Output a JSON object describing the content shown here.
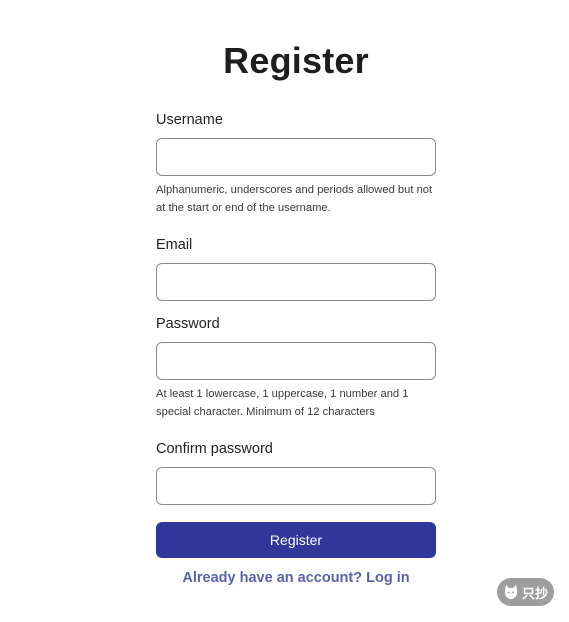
{
  "page": {
    "title": "Register"
  },
  "form": {
    "username": {
      "label": "Username",
      "value": "",
      "hint": "Alphanumeric, underscores and periods allowed but not at the start or end of the username."
    },
    "email": {
      "label": "Email",
      "value": ""
    },
    "password": {
      "label": "Password",
      "value": "",
      "hint": "At least 1 lowercase, 1 uppercase, 1 number and 1 special character. Minimum of 12 characters"
    },
    "confirm_password": {
      "label": "Confirm password",
      "value": ""
    },
    "submit_label": "Register",
    "login_link": "Already have an account? Log in"
  },
  "badge": {
    "text": "只抄",
    "icon": "cat-icon"
  },
  "colors": {
    "primary_button": "#31369b",
    "link": "#5b62ad",
    "input_border": "#8a8a8a",
    "badge_bg": "#9e9e9e"
  }
}
